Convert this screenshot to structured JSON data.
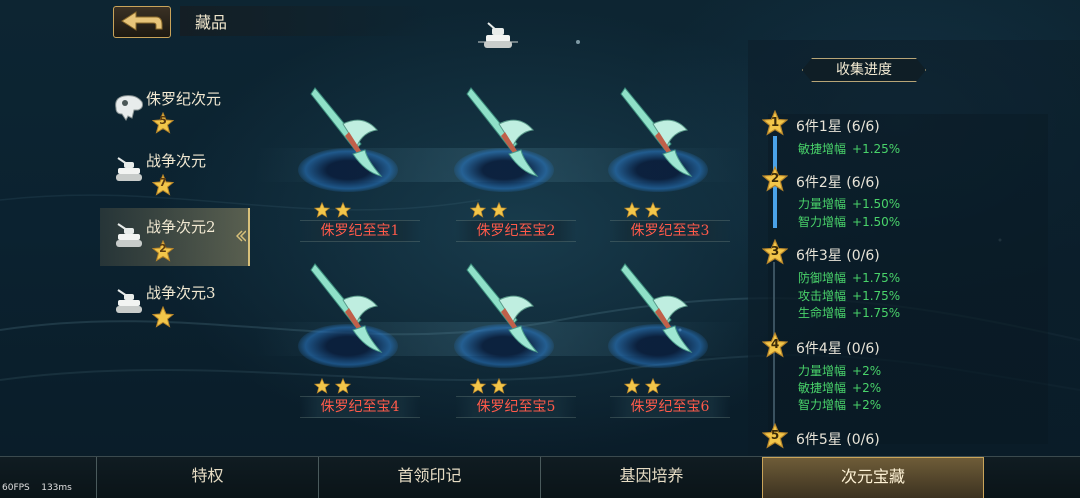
{
  "header": {
    "title": "藏品"
  },
  "categories": [
    {
      "name": "侏罗纪次元",
      "stars": "5",
      "icon": "dino-skull-icon",
      "selected": false
    },
    {
      "name": "战争次元",
      "stars": "7",
      "icon": "tank-icon",
      "selected": false
    },
    {
      "name": "战争次元2",
      "stars": "2",
      "icon": "tank-icon",
      "selected": true
    },
    {
      "name": "战争次元3",
      "stars": "",
      "icon": "tank-icon",
      "selected": false
    }
  ],
  "items": [
    {
      "name": "侏罗纪至宝1",
      "stars": 2
    },
    {
      "name": "侏罗纪至宝2",
      "stars": 2
    },
    {
      "name": "侏罗纪至宝3",
      "stars": 2
    },
    {
      "name": "侏罗纪至宝4",
      "stars": 2
    },
    {
      "name": "侏罗纪至宝5",
      "stars": 2
    },
    {
      "name": "侏罗纪至宝6",
      "stars": 2
    }
  ],
  "progress": {
    "title": "收集进度",
    "tiers": [
      {
        "star": "1",
        "label": "6件1星 (6/6)",
        "bonuses": [
          {
            "name": "敏捷增幅",
            "value": "+1.25%"
          }
        ]
      },
      {
        "star": "2",
        "label": "6件2星 (6/6)",
        "bonuses": [
          {
            "name": "力量增幅",
            "value": "+1.50%"
          },
          {
            "name": "智力增幅",
            "value": "+1.50%"
          }
        ]
      },
      {
        "star": "3",
        "label": "6件3星 (0/6)",
        "bonuses": [
          {
            "name": "防御增幅",
            "value": "+1.75%"
          },
          {
            "name": "攻击增幅",
            "value": "+1.75%"
          },
          {
            "name": "生命增幅",
            "value": "+1.75%"
          }
        ]
      },
      {
        "star": "4",
        "label": "6件4星 (0/6)",
        "bonuses": [
          {
            "name": "力量增幅",
            "value": "+2%"
          },
          {
            "name": "敏捷增幅",
            "value": "+2%"
          },
          {
            "name": "智力增幅",
            "value": "+2%"
          }
        ]
      },
      {
        "star": "5",
        "label": "6件5星 (0/6)",
        "bonuses": []
      }
    ]
  },
  "tabs": [
    {
      "label": "特权",
      "active": false
    },
    {
      "label": "首领印记",
      "active": false
    },
    {
      "label": "基因培养",
      "active": false
    },
    {
      "label": "次元宝藏",
      "active": true
    }
  ],
  "debug": {
    "fps": "60FPS",
    "ms": "133ms"
  },
  "colors": {
    "gold": "#c9a45a",
    "bonus_green": "#49d36a",
    "item_red": "#ff5a4a",
    "progress_blue": "#4aa2e8"
  }
}
